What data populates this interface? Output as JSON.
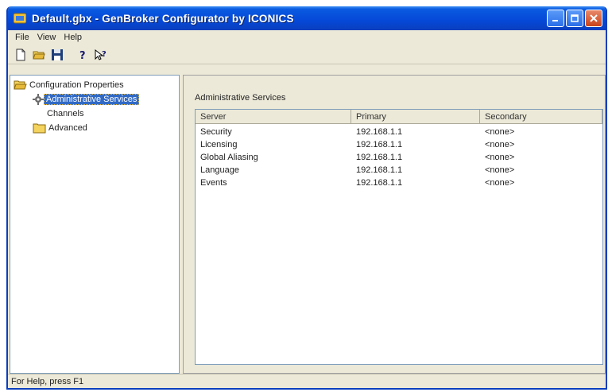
{
  "window": {
    "title": "Default.gbx - GenBroker Configurator by ICONICS"
  },
  "menu": {
    "items": [
      "File",
      "View",
      "Help"
    ]
  },
  "toolbar": {
    "buttons": [
      "new-document-icon",
      "open-folder-icon",
      "save-disk-icon",
      "help-icon",
      "context-help-icon"
    ]
  },
  "tree": {
    "root_label": "Configuration Properties",
    "items": [
      {
        "label": "Administrative Services",
        "selected": true
      },
      {
        "label": "Channels",
        "selected": false
      },
      {
        "label": "Advanced",
        "selected": false
      }
    ]
  },
  "main": {
    "group_label": "Administrative Services",
    "columns": [
      "Server",
      "Primary",
      "Secondary"
    ],
    "rows": [
      [
        "Security",
        "192.168.1.1",
        "<none>"
      ],
      [
        "Licensing",
        "192.168.1.1",
        "<none>"
      ],
      [
        "Global Aliasing",
        "192.168.1.1",
        "<none>"
      ],
      [
        "Language",
        "192.168.1.1",
        "<none>"
      ],
      [
        "Events",
        "192.168.1.1",
        "<none>"
      ]
    ]
  },
  "status": {
    "text": "For Help, press F1"
  },
  "colors": {
    "title_blue": "#0548d8",
    "selection_blue": "#316ac5",
    "face": "#ece9d8"
  }
}
